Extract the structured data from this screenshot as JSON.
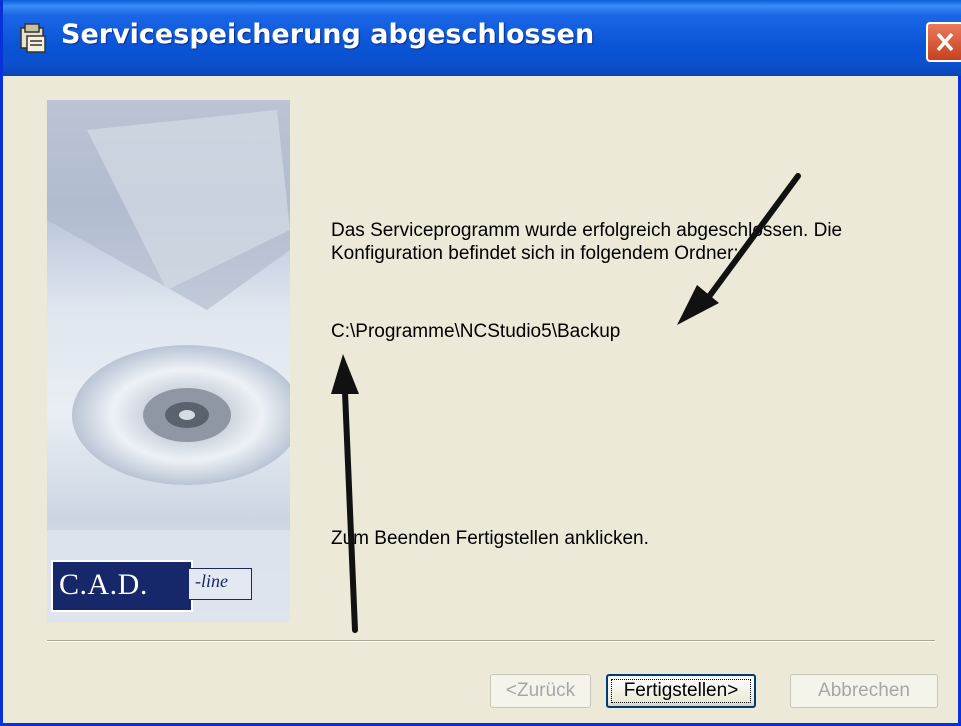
{
  "window": {
    "title": "Servicespeicherung abgeschlossen",
    "title_bar_color": "#0a55d6"
  },
  "content": {
    "message": "Das Serviceprogramm wurde erfolgreich abgeschlossen. Die Konfiguration befindet sich in folgendem Ordner:",
    "folder_path": "C:\\Programme\\NCStudio5\\Backup",
    "finish_note": "Zum Beenden Fertigstellen anklicken."
  },
  "logo": {
    "main": "C.A.D.",
    "sub": "-line"
  },
  "buttons": {
    "back": "<Zurück",
    "finish": "Fertigstellen>",
    "cancel": "Abbrechen"
  },
  "icons": {
    "title_icon": "wizard-app-icon",
    "close": "close-icon",
    "annotation_arrows": "arrow-icon"
  }
}
